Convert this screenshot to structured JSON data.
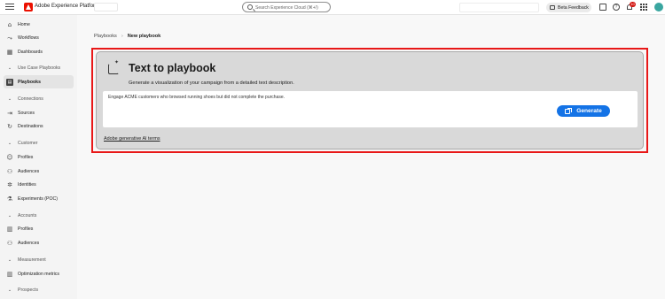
{
  "header": {
    "app_title": "Adobe Experience Platform",
    "search_placeholder": "Search Experience Cloud (⌘+/)",
    "beta_feedback": "Beta Feedback",
    "notification_count": "10",
    "help_glyph": "?"
  },
  "sidebar": {
    "items": [
      {
        "label": "Home",
        "icon": "home-icon",
        "glyph": "⌂"
      },
      {
        "label": "Workflows",
        "icon": "workflows-icon",
        "glyph": "⤳"
      },
      {
        "label": "Dashboards",
        "icon": "dashboards-icon",
        "glyph": "▦"
      },
      {
        "label": "Use Case Playbooks",
        "icon": "chevron-down-icon",
        "glyph": "⌄",
        "section": true
      },
      {
        "label": "Playbooks",
        "icon": "playbooks-icon",
        "glyph": "▤",
        "active": true
      },
      {
        "label": "Connections",
        "icon": "chevron-down-icon",
        "glyph": "⌄",
        "section": true
      },
      {
        "label": "Sources",
        "icon": "sources-icon",
        "glyph": "⇥"
      },
      {
        "label": "Destinations",
        "icon": "destinations-icon",
        "glyph": "↻"
      },
      {
        "label": "Customer",
        "icon": "chevron-down-icon",
        "glyph": "⌄",
        "section": true
      },
      {
        "label": "Profiles",
        "icon": "profile-icon",
        "glyph": "☺"
      },
      {
        "label": "Audiences",
        "icon": "audiences-icon",
        "glyph": "⚇"
      },
      {
        "label": "Identities",
        "icon": "identities-icon",
        "glyph": "✲"
      },
      {
        "label": "Experiments (POC)",
        "icon": "experiments-icon",
        "glyph": "⚗"
      },
      {
        "label": "Accounts",
        "icon": "chevron-down-icon",
        "glyph": "⌄",
        "section": true
      },
      {
        "label": "Profiles",
        "icon": "account-profiles-icon",
        "glyph": "▥"
      },
      {
        "label": "Audiences",
        "icon": "account-audiences-icon",
        "glyph": "⚇"
      },
      {
        "label": "Measurement",
        "icon": "chevron-down-icon",
        "glyph": "⌄",
        "section": true
      },
      {
        "label": "Optimization metrics",
        "icon": "metrics-icon",
        "glyph": "▥"
      },
      {
        "label": "Prospects",
        "icon": "chevron-down-icon",
        "glyph": "⌄",
        "section": true
      }
    ]
  },
  "breadcrumb": {
    "parent": "Playbooks",
    "separator": "›",
    "current": "New playbook"
  },
  "card": {
    "title": "Text to playbook",
    "subtitle": "Generate a visualization of your campaign from a detailed text description.",
    "prompt_value": "Engage ACME customers who browsed running shoes but did not complete the purchase.",
    "generate_label": "Generate",
    "terms_link": "Adobe generative AI terms"
  },
  "colors": {
    "accent": "#1473e6",
    "highlight_border": "#e81818",
    "brand": "#eb1000",
    "badge": "#d31510"
  }
}
